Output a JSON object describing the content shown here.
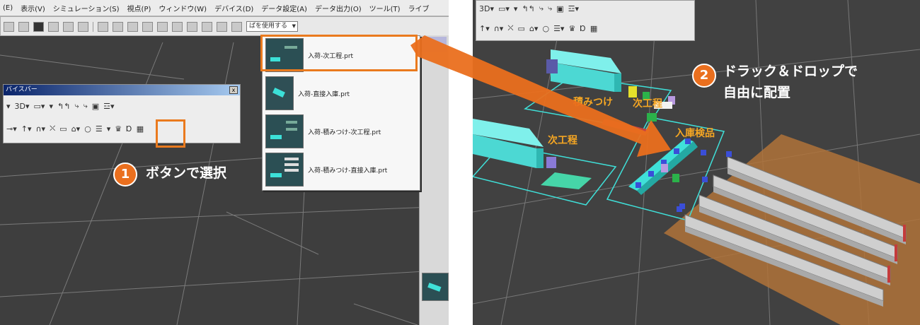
{
  "menubar": {
    "items": [
      "(E)",
      "表示(V)",
      "シミュレーション(S)",
      "視点(P)",
      "ウィンドウ(W)",
      "デバイス(D)",
      "データ設定(A)",
      "データ出力(O)",
      "ツール(T)",
      "ライブ"
    ]
  },
  "toolbar_main": {
    "combo_value": "ばを使用する"
  },
  "device_bar": {
    "title": "バイスバー",
    "close_label": "x",
    "row1": [
      "▾",
      "3D▾",
      "▭▾",
      "▾",
      "↰↰",
      "⤷",
      "⤷",
      "▣",
      "☲▾"
    ],
    "row2": [
      "⊸▾",
      "↑▾",
      "∩▾",
      "⛌",
      "▭",
      "⌂▾",
      "○",
      "☰",
      "▾",
      "♛",
      "Ɒ",
      "▦"
    ]
  },
  "dropdown": {
    "items": [
      {
        "label": "入荷-次工程.prt",
        "selected": true
      },
      {
        "label": "入荷-直接入庫.prt",
        "selected": false
      },
      {
        "label": "入荷-積みつけ-次工程.prt",
        "selected": false
      },
      {
        "label": "入荷-積みつけ-直接入庫.prt",
        "selected": false
      }
    ]
  },
  "step1": {
    "number": "1",
    "text": "ボタンで選択"
  },
  "step2": {
    "number": "2",
    "line1": "ドラック＆ドロップで",
    "line2": "自由に配置"
  },
  "right_toolbar": {
    "row1": [
      "3D▾",
      "▭▾",
      "▾",
      "↰↰",
      "⤷",
      "⤷",
      "▣",
      "☲▾"
    ],
    "row2": [
      "↑▾",
      "∩▾",
      "⛌",
      "▭",
      "⌂▾",
      "○",
      "☰▾",
      "♛",
      "Ɒ",
      "▦"
    ]
  },
  "scene_labels": {
    "loading": "積みつけ",
    "next_process_a": "次工程",
    "next_process_b": "次工程",
    "inspection": "入庫検品"
  },
  "colors": {
    "accent": "#ea7a1e",
    "cyan": "#3fe0d9",
    "label": "#f5a623",
    "floor": "#414141"
  }
}
